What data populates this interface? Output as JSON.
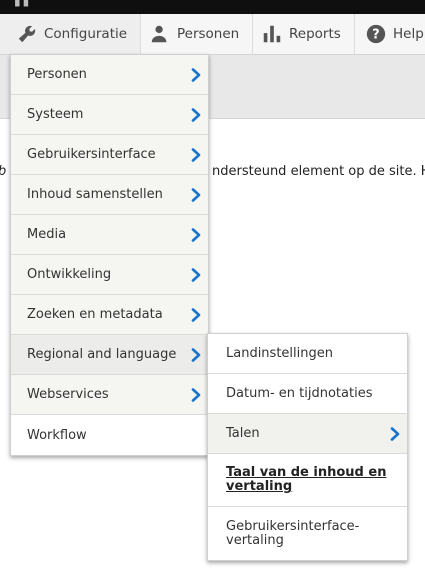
{
  "toolbar": {
    "tabs": [
      {
        "label": "Configuratie",
        "icon": "wrench-icon"
      },
      {
        "label": "Personen",
        "icon": "person-icon"
      },
      {
        "label": "Reports",
        "icon": "bar-chart-icon"
      },
      {
        "label": "Help",
        "icon": "help-icon"
      }
    ]
  },
  "page": {
    "text_left": "b",
    "text_right": "ndersteund element op de site. Het"
  },
  "menu": {
    "items": [
      {
        "label": "Personen"
      },
      {
        "label": "Systeem"
      },
      {
        "label": "Gebruikersinterface"
      },
      {
        "label": "Inhoud samenstellen"
      },
      {
        "label": "Media"
      },
      {
        "label": "Ontwikkeling"
      },
      {
        "label": "Zoeken en metadata"
      },
      {
        "label": "Regional and language"
      },
      {
        "label": "Webservices"
      },
      {
        "label": "Workflow"
      }
    ]
  },
  "submenu": {
    "items": [
      {
        "label": "Landinstellingen"
      },
      {
        "label": "Datum- en tijdnotaties"
      },
      {
        "label": "Talen"
      },
      {
        "label": "Taal van de inhoud en vertaling"
      },
      {
        "label": "Gebruikersinterface-vertaling"
      }
    ]
  },
  "colors": {
    "accent": "#1a73c8",
    "toolbar_dark": "#0f0f0f"
  }
}
